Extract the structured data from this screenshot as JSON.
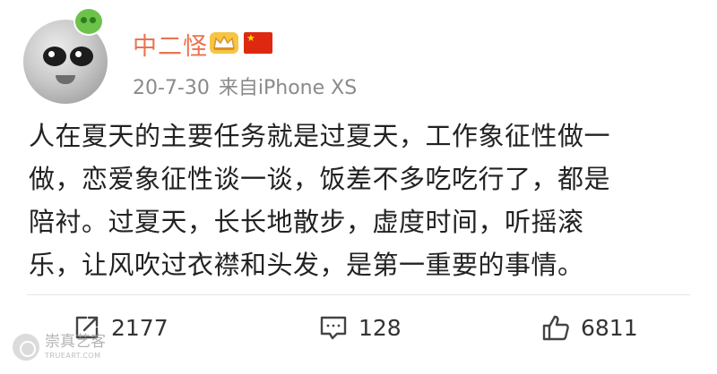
{
  "user": {
    "name": "中二怪",
    "timestamp": "20-7-30",
    "source": "来自iPhone XS"
  },
  "post": {
    "lines": [
      "人在夏天的主要任务就是过夏天，工作象征性做一",
      "做，恋爱象征性谈一谈，饭差不多吃吃行了，都是",
      "陪衬。过夏天，长长地散步，虚度时间，听摇滚",
      "乐，让风吹过衣襟和头发，是第一重要的事情。"
    ]
  },
  "actions": {
    "repost_count": "2177",
    "comment_count": "128",
    "like_count": "6811"
  },
  "watermark": {
    "name": "崇真艺客",
    "url": "TRUEART.COM"
  },
  "icons": {
    "avatar_badge": "green-blob-icon",
    "vip": "crown-icon",
    "flag": "china-flag-icon",
    "repost": "repost-icon",
    "comment": "comment-icon",
    "like": "thumbs-up-icon"
  },
  "colors": {
    "username": "#eb7350",
    "meta": "#8a8a8a",
    "text": "#222222",
    "vip_badge": "#f6c543",
    "flag": "#de2910"
  }
}
